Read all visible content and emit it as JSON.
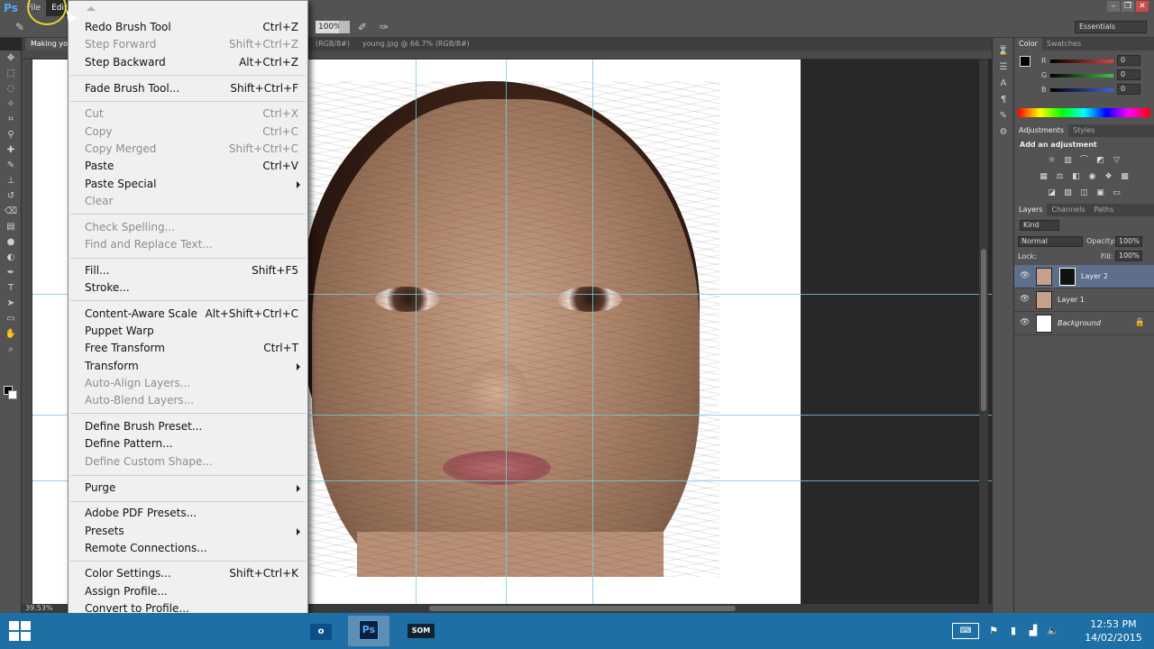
{
  "app": {
    "logo": "Ps",
    "menus": [
      "File",
      "Edit"
    ],
    "active_menu": "Edit",
    "workspace": "Essentials",
    "zoom_field": "100%",
    "status_zoom": "39.53%"
  },
  "doc_tabs": [
    {
      "label": "Making yo...",
      "active": true
    },
    {
      "label": "(RGB/8#)",
      "active": false
    },
    {
      "label": "young.jpg @ 66.7% (RGB/8#)",
      "active": false
    }
  ],
  "edit_menu": {
    "items": [
      {
        "label": "Redo Brush Tool",
        "shortcut": "Ctrl+Z",
        "enabled": true
      },
      {
        "label": "Step Forward",
        "shortcut": "Shift+Ctrl+Z",
        "enabled": false
      },
      {
        "label": "Step Backward",
        "shortcut": "Alt+Ctrl+Z",
        "enabled": true
      },
      {
        "label": "Fade Brush Tool...",
        "shortcut": "Shift+Ctrl+F",
        "enabled": true
      },
      {
        "label": "Cut",
        "shortcut": "Ctrl+X",
        "enabled": false
      },
      {
        "label": "Copy",
        "shortcut": "Ctrl+C",
        "enabled": false
      },
      {
        "label": "Copy Merged",
        "shortcut": "Shift+Ctrl+C",
        "enabled": false
      },
      {
        "label": "Paste",
        "shortcut": "Ctrl+V",
        "enabled": true
      },
      {
        "label": "Paste Special",
        "shortcut": "",
        "enabled": true,
        "submenu": true
      },
      {
        "label": "Clear",
        "shortcut": "",
        "enabled": false
      },
      {
        "label": "Check Spelling...",
        "shortcut": "",
        "enabled": false
      },
      {
        "label": "Find and Replace Text...",
        "shortcut": "",
        "enabled": false
      },
      {
        "label": "Fill...",
        "shortcut": "Shift+F5",
        "enabled": true
      },
      {
        "label": "Stroke...",
        "shortcut": "",
        "enabled": true
      },
      {
        "label": "Content-Aware Scale",
        "shortcut": "Alt+Shift+Ctrl+C",
        "enabled": true
      },
      {
        "label": "Puppet Warp",
        "shortcut": "",
        "enabled": true
      },
      {
        "label": "Free Transform",
        "shortcut": "Ctrl+T",
        "enabled": true
      },
      {
        "label": "Transform",
        "shortcut": "",
        "enabled": true,
        "submenu": true
      },
      {
        "label": "Auto-Align Layers...",
        "shortcut": "",
        "enabled": false
      },
      {
        "label": "Auto-Blend Layers...",
        "shortcut": "",
        "enabled": false
      },
      {
        "label": "Define Brush Preset...",
        "shortcut": "",
        "enabled": true
      },
      {
        "label": "Define Pattern...",
        "shortcut": "",
        "enabled": true
      },
      {
        "label": "Define Custom Shape...",
        "shortcut": "",
        "enabled": false
      },
      {
        "label": "Purge",
        "shortcut": "",
        "enabled": true,
        "submenu": true
      },
      {
        "label": "Adobe PDF Presets...",
        "shortcut": "",
        "enabled": true
      },
      {
        "label": "Presets",
        "shortcut": "",
        "enabled": true,
        "submenu": true
      },
      {
        "label": "Remote Connections...",
        "shortcut": "",
        "enabled": true
      },
      {
        "label": "Color Settings...",
        "shortcut": "Shift+Ctrl+K",
        "enabled": true
      },
      {
        "label": "Assign Profile...",
        "shortcut": "",
        "enabled": true
      },
      {
        "label": "Convert to Profile...",
        "shortcut": "",
        "enabled": true
      }
    ]
  },
  "color_panel": {
    "tabs": [
      "Color",
      "Swatches"
    ],
    "channels": [
      {
        "label": "R",
        "value": "0",
        "color": "#e04040"
      },
      {
        "label": "G",
        "value": "0",
        "color": "#40c040"
      },
      {
        "label": "B",
        "value": "0",
        "color": "#4060e0"
      }
    ]
  },
  "adjustments_panel": {
    "tabs": [
      "Adjustments",
      "Styles"
    ],
    "title": "Add an adjustment"
  },
  "layers_panel": {
    "tabs": [
      "Layers",
      "Channels",
      "Paths"
    ],
    "kind_filter": "Kind",
    "blend_mode": "Normal",
    "opacity_label": "Opacity:",
    "opacity": "100%",
    "lock_label": "Lock:",
    "fill_label": "Fill:",
    "fill": "100%",
    "layers": [
      {
        "name": "Layer 2",
        "selected": true,
        "has_mask": true
      },
      {
        "name": "Layer 1",
        "selected": false,
        "has_mask": false
      },
      {
        "name": "Background",
        "selected": false,
        "has_mask": false,
        "locked": true
      }
    ]
  },
  "taskbar": {
    "ps_label": "Ps",
    "som_label": "SOM",
    "outlook_label": "o",
    "time": "12:53 PM",
    "date": "14/02/2015"
  },
  "colors": {
    "ui_dark": "#535353",
    "canvas_bg": "#282828",
    "guide": "#6fd0e6",
    "taskbar": "#1e6fa6",
    "selected_layer": "#5c6f8c"
  }
}
